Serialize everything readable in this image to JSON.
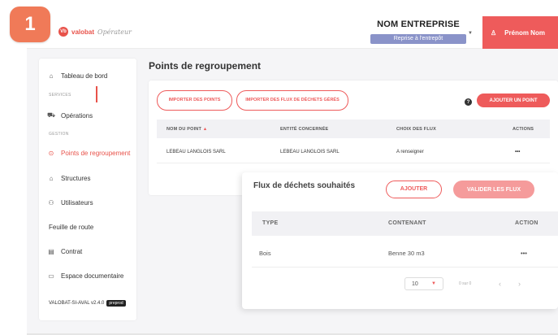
{
  "step_number": "1",
  "logo": {
    "mark": "Vb",
    "text": "valobat",
    "script": "Opérateur"
  },
  "header": {
    "company_name": "NOM ENTREPRISE",
    "company_sub": "Reprise à l'entrepôt",
    "user_name": "Prénom Nom",
    "brand_color": "#ee5b5b"
  },
  "sidebar": {
    "dashboard": "Tableau de bord",
    "section_services": "SERVICES",
    "operations": "Opérations",
    "section_gestion": "GESTION",
    "points": "Points de regroupement",
    "structures": "Structures",
    "users": "Utilisateurs",
    "roadmap": "Feuille de route",
    "contract": "Contrat",
    "docs": "Espace documentaire",
    "version": "VALOBAT-SI-AVAL v2.4.0",
    "env": "preprod"
  },
  "page": {
    "title": "Points de regroupement",
    "btn_import_points": "IMPORTER DES POINTS",
    "btn_import_flux": "IMPORTER DES FLUX DE DÉCHETS GÉRÉS",
    "btn_add_point": "AJOUTER UN POINT",
    "table": {
      "headers": {
        "name": "NOM DU POINT",
        "entity": "ENTITÉ CONCERNÉE",
        "flux": "CHOIX DES FLUX",
        "actions": "ACTIONS"
      },
      "row": {
        "name": "LEBEAU LANGLOIS SARL",
        "entity": "LEBEAU LANGLOIS SARL",
        "flux": "A renseigner",
        "actions": "•••"
      }
    }
  },
  "modal": {
    "title": "Flux de déchets souhaités",
    "btn_add": "AJOUTER",
    "btn_validate": "VALIDER LES FLUX",
    "headers": {
      "type": "TYPE",
      "container": "CONTENANT",
      "actions": "ACTION"
    },
    "row": {
      "type": "Bois",
      "container": "Benne 30 m3",
      "actions": "•••"
    },
    "pagination": {
      "per_page": "10",
      "info": "0 sur 0"
    }
  }
}
